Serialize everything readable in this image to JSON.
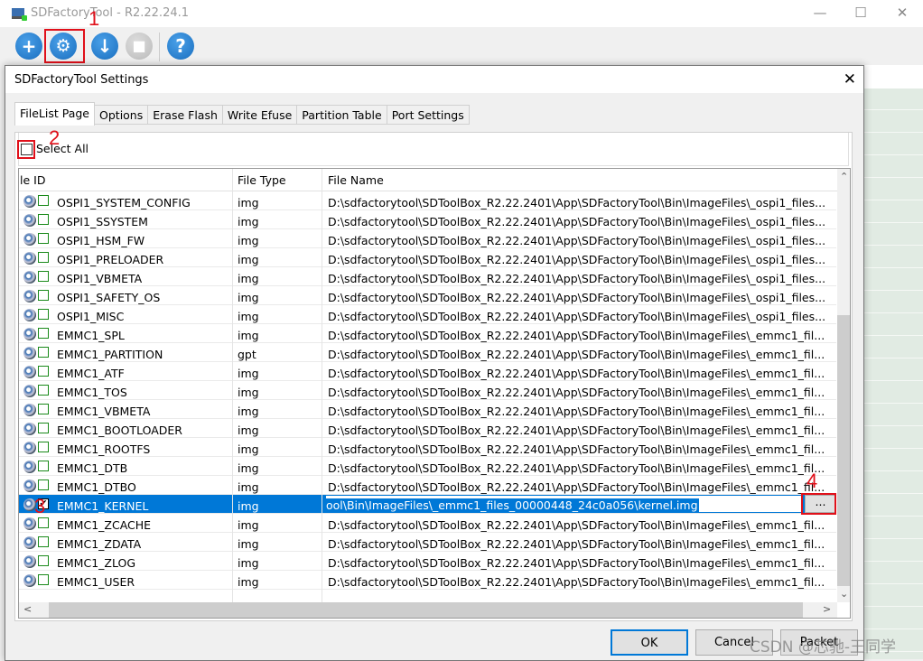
{
  "window": {
    "title": "SDFactoryTool - R2.22.24.1",
    "minimize": "—",
    "maximize": "☐",
    "close": "✕"
  },
  "toolbar": {
    "buttons": [
      {
        "icon": "add-icon",
        "glyph": "+"
      },
      {
        "icon": "gear-icon",
        "glyph": "⚙"
      },
      {
        "icon": "download-icon",
        "glyph": "↓"
      },
      {
        "icon": "stop-icon",
        "glyph": "■",
        "disabled": true
      },
      {
        "icon": "help-icon",
        "glyph": "?"
      }
    ]
  },
  "annotations": [
    "1",
    "2",
    "3",
    "4"
  ],
  "dialog": {
    "title": "SDFactoryTool Settings",
    "close": "✕",
    "tabs": [
      "FileList Page",
      "Options",
      "Erase Flash",
      "Write Efuse",
      "Partition Table",
      "Port Settings"
    ],
    "active_tab": "FileList Page",
    "select_all_label": "Select All",
    "columns": [
      "le ID",
      "File Type",
      "File Name"
    ],
    "rows": [
      {
        "id": "OSPI1_SYSTEM_CONFIG",
        "type": "img",
        "file": "D:\\sdfactorytool\\SDToolBox_R2.22.2401\\App\\SDFactoryTool\\Bin\\ImageFiles\\_ospi1_files...",
        "checked": false
      },
      {
        "id": "OSPI1_SSYSTEM",
        "type": "img",
        "file": "D:\\sdfactorytool\\SDToolBox_R2.22.2401\\App\\SDFactoryTool\\Bin\\ImageFiles\\_ospi1_files...",
        "checked": false
      },
      {
        "id": "OSPI1_HSM_FW",
        "type": "img",
        "file": "D:\\sdfactorytool\\SDToolBox_R2.22.2401\\App\\SDFactoryTool\\Bin\\ImageFiles\\_ospi1_files...",
        "checked": false
      },
      {
        "id": "OSPI1_PRELOADER",
        "type": "img",
        "file": "D:\\sdfactorytool\\SDToolBox_R2.22.2401\\App\\SDFactoryTool\\Bin\\ImageFiles\\_ospi1_files...",
        "checked": false
      },
      {
        "id": "OSPI1_VBMETA",
        "type": "img",
        "file": "D:\\sdfactorytool\\SDToolBox_R2.22.2401\\App\\SDFactoryTool\\Bin\\ImageFiles\\_ospi1_files...",
        "checked": false
      },
      {
        "id": "OSPI1_SAFETY_OS",
        "type": "img",
        "file": "D:\\sdfactorytool\\SDToolBox_R2.22.2401\\App\\SDFactoryTool\\Bin\\ImageFiles\\_ospi1_files...",
        "checked": false
      },
      {
        "id": "OSPI1_MISC",
        "type": "img",
        "file": "D:\\sdfactorytool\\SDToolBox_R2.22.2401\\App\\SDFactoryTool\\Bin\\ImageFiles\\_ospi1_files...",
        "checked": false
      },
      {
        "id": "EMMC1_SPL",
        "type": "img",
        "file": "D:\\sdfactorytool\\SDToolBox_R2.22.2401\\App\\SDFactoryTool\\Bin\\ImageFiles\\_emmc1_fil...",
        "checked": false
      },
      {
        "id": "EMMC1_PARTITION",
        "type": "gpt",
        "file": "D:\\sdfactorytool\\SDToolBox_R2.22.2401\\App\\SDFactoryTool\\Bin\\ImageFiles\\_emmc1_fil...",
        "checked": false
      },
      {
        "id": "EMMC1_ATF",
        "type": "img",
        "file": "D:\\sdfactorytool\\SDToolBox_R2.22.2401\\App\\SDFactoryTool\\Bin\\ImageFiles\\_emmc1_fil...",
        "checked": false
      },
      {
        "id": "EMMC1_TOS",
        "type": "img",
        "file": "D:\\sdfactorytool\\SDToolBox_R2.22.2401\\App\\SDFactoryTool\\Bin\\ImageFiles\\_emmc1_fil...",
        "checked": false
      },
      {
        "id": "EMMC1_VBMETA",
        "type": "img",
        "file": "D:\\sdfactorytool\\SDToolBox_R2.22.2401\\App\\SDFactoryTool\\Bin\\ImageFiles\\_emmc1_fil...",
        "checked": false
      },
      {
        "id": "EMMC1_BOOTLOADER",
        "type": "img",
        "file": "D:\\sdfactorytool\\SDToolBox_R2.22.2401\\App\\SDFactoryTool\\Bin\\ImageFiles\\_emmc1_fil...",
        "checked": false
      },
      {
        "id": "EMMC1_ROOTFS",
        "type": "img",
        "file": "D:\\sdfactorytool\\SDToolBox_R2.22.2401\\App\\SDFactoryTool\\Bin\\ImageFiles\\_emmc1_fil...",
        "checked": false
      },
      {
        "id": "EMMC1_DTB",
        "type": "img",
        "file": "D:\\sdfactorytool\\SDToolBox_R2.22.2401\\App\\SDFactoryTool\\Bin\\ImageFiles\\_emmc1_fil...",
        "checked": false
      },
      {
        "id": "EMMC1_DTBO",
        "type": "img",
        "file": "D:\\sdfactorytool\\SDToolBox_R2.22.2401\\App\\SDFactoryTool\\Bin\\ImageFiles\\_emmc1_fil...",
        "checked": false
      },
      {
        "id": "EMMC1_KERNEL",
        "type": "img",
        "file": "ool\\Bin\\ImageFiles\\_emmc1_files_00000448_24c0a056\\kernel.img",
        "checked": true,
        "selected": true,
        "browse": "..."
      },
      {
        "id": "EMMC1_ZCACHE",
        "type": "img",
        "file": "D:\\sdfactorytool\\SDToolBox_R2.22.2401\\App\\SDFactoryTool\\Bin\\ImageFiles\\_emmc1_fil...",
        "checked": false
      },
      {
        "id": "EMMC1_ZDATA",
        "type": "img",
        "file": "D:\\sdfactorytool\\SDToolBox_R2.22.2401\\App\\SDFactoryTool\\Bin\\ImageFiles\\_emmc1_fil...",
        "checked": false
      },
      {
        "id": "EMMC1_ZLOG",
        "type": "img",
        "file": "D:\\sdfactorytool\\SDToolBox_R2.22.2401\\App\\SDFactoryTool\\Bin\\ImageFiles\\_emmc1_fil...",
        "checked": false
      },
      {
        "id": "EMMC1_USER",
        "type": "img",
        "file": "D:\\sdfactorytool\\SDToolBox_R2.22.2401\\App\\SDFactoryTool\\Bin\\ImageFiles\\_emmc1_fil...",
        "checked": false
      }
    ],
    "buttons": {
      "ok": "OK",
      "cancel": "Cancel",
      "packet": "Packet"
    }
  },
  "watermark": "CSDN @芯驰-王同学",
  "colors": {
    "accent": "#0078d7",
    "annotation": "#e0101a"
  }
}
